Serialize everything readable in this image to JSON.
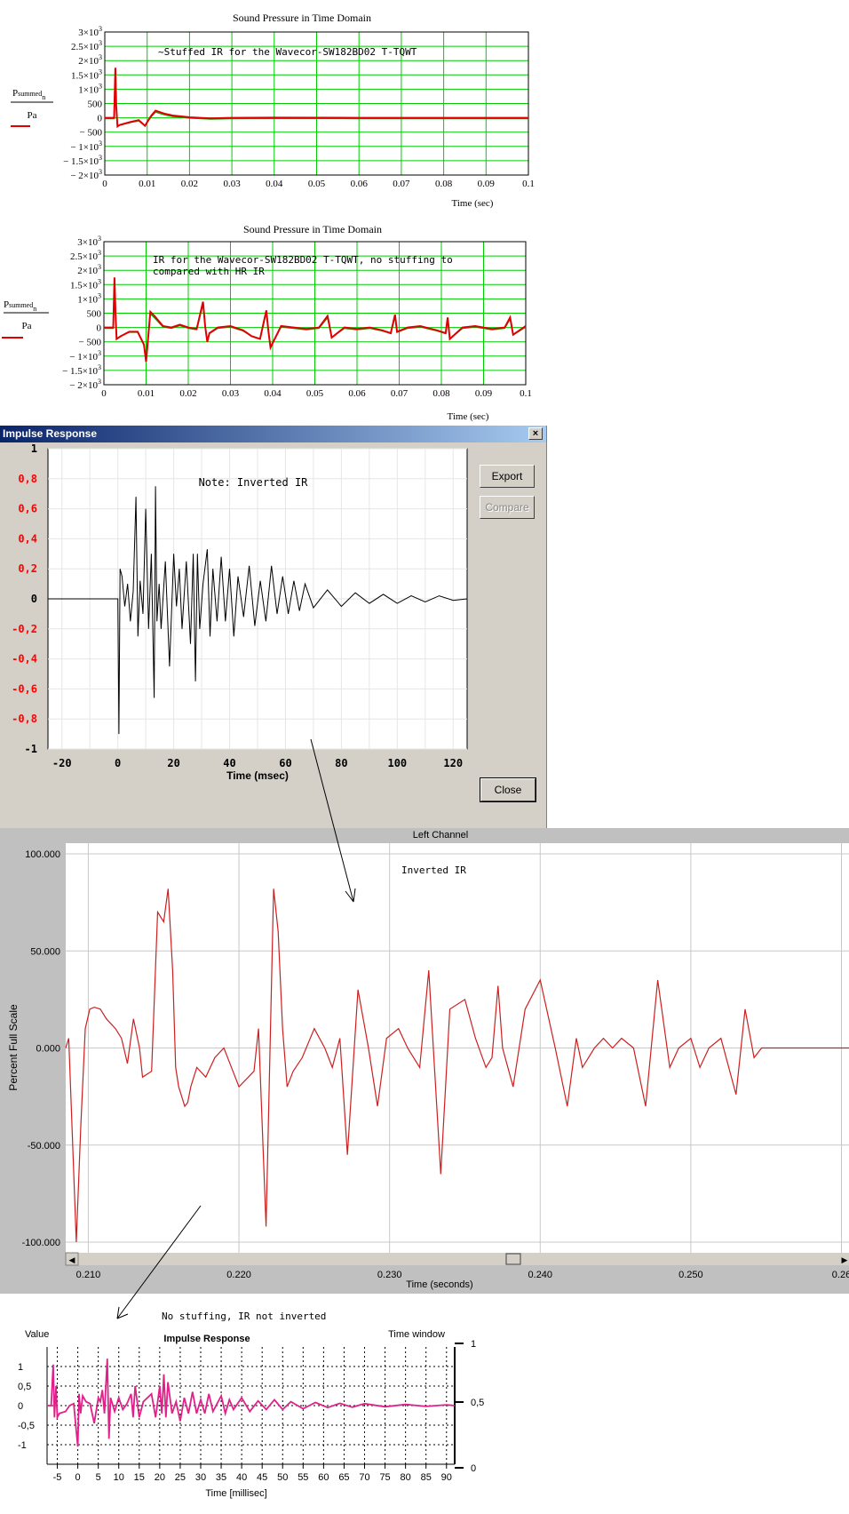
{
  "colors": {
    "grid_green": "#00cc00",
    "trace_red": "#e00000",
    "trace_green": "#00aa00",
    "label_red": "#ff0000",
    "dialog_bg": "#d4d0c8",
    "trace_magenta": "#e0218a",
    "lc_red": "#cc2020"
  },
  "chart1": {
    "title": "Sound Pressure in Time Domain",
    "annotation": "~Stuffed IR for the Wavecor-SW182BD02 T-TQWT",
    "ylabel_top": "P",
    "ylabel_sub": "summed",
    "ylabel_idx": "n",
    "ylabel_unit": "Pa",
    "xlabel": "Time (sec)",
    "yticks": [
      "3×10",
      "2.5×10",
      "2×10",
      "1.5×10",
      "1×10",
      "500",
      "0",
      "− 500",
      "− 1×10",
      "− 1.5×10",
      "− 2×10"
    ],
    "yexp": [
      "3",
      "3",
      "3",
      "3",
      "3",
      "",
      "",
      "",
      "3",
      "3",
      "3"
    ],
    "xticks": [
      "0",
      "0.01",
      "0.02",
      "0.03",
      "0.04",
      "0.05",
      "0.06",
      "0.07",
      "0.08",
      "0.09",
      "0.1"
    ]
  },
  "chart2": {
    "title": "Sound Pressure in Time Domain",
    "annotation_l1": "IR for the Wavecor-SW182BD02 T-TQWT, no stuffing to",
    "annotation_l2": "compared with HR IR",
    "ylabel_top": "P",
    "ylabel_sub": "summed",
    "ylabel_idx": "n",
    "ylabel_unit": "Pa",
    "xlabel": "Time (sec)",
    "yticks": [
      "3×10",
      "2.5×10",
      "2×10",
      "1.5×10",
      "1×10",
      "500",
      "0",
      "− 500",
      "− 1×10",
      "− 1.5×10",
      "− 2×10"
    ],
    "yexp": [
      "3",
      "3",
      "3",
      "3",
      "3",
      "",
      "",
      "",
      "3",
      "3",
      "3"
    ],
    "xticks": [
      "0",
      "0.01",
      "0.02",
      "0.03",
      "0.04",
      "0.05",
      "0.06",
      "0.07",
      "0.08",
      "0.09",
      "0.1"
    ]
  },
  "dialog": {
    "title": "Impulse Response",
    "close_x": "×",
    "export_label": "Export",
    "compare_label": "Compare",
    "close_label": "Close",
    "note": "Note: Inverted IR",
    "yticks": [
      "1",
      "0,8",
      "0,6",
      "0,4",
      "0,2",
      "0",
      "-0,2",
      "-0,4",
      "-0,6",
      "-0,8",
      "-1"
    ],
    "xticks": [
      "-20",
      "0",
      "20",
      "40",
      "60",
      "80",
      "100",
      "120"
    ],
    "xlabel": "Time (msec)"
  },
  "left_channel": {
    "title": "Left Channel",
    "annotation": "Inverted IR",
    "ylabel": "Percent Full Scale",
    "yticks": [
      "100.000",
      "50.000",
      "0.000",
      "-50.000",
      "-100.000"
    ],
    "xticks": [
      "0.210",
      "0.220",
      "0.230",
      "0.240",
      "0.250",
      "0.26"
    ],
    "xlabel": "Time (seconds)",
    "scroll_left": "◀",
    "scroll_right": "▶"
  },
  "chart5": {
    "caption": "No stuffing,  IR not inverted",
    "title": "Impulse Response",
    "value_label": "Value",
    "time_window_label": "Time window",
    "yticks": [
      "1",
      "0,5",
      "0",
      "-0,5",
      "-1"
    ],
    "y2ticks": [
      "1",
      "0,5",
      "0"
    ],
    "xticks": [
      "-5",
      "0",
      "5",
      "10",
      "15",
      "20",
      "25",
      "30",
      "35",
      "40",
      "45",
      "50",
      "55",
      "60",
      "65",
      "70",
      "75",
      "80",
      "85",
      "90"
    ],
    "xlabel": "Time [millisec]"
  },
  "chart_data": [
    {
      "type": "line",
      "title": "Sound Pressure in Time Domain",
      "xlabel": "Time (sec)",
      "ylabel": "P summed n / Pa",
      "xlim": [
        0,
        0.1
      ],
      "ylim": [
        -2000,
        3000
      ],
      "grid": true,
      "series": [
        {
          "x": [
            0,
            0.0022,
            0.0025,
            0.0027,
            0.003,
            0.0035,
            0.006,
            0.008,
            0.0095,
            0.0102,
            0.011,
            0.012,
            0.014,
            0.016,
            0.02,
            0.025,
            0.03,
            0.04,
            0.06,
            0.1
          ],
          "y": [
            0,
            0,
            1750,
            400,
            -300,
            -250,
            -150,
            -80,
            -280,
            -100,
            80,
            250,
            150,
            80,
            20,
            -20,
            0,
            5,
            0,
            0
          ]
        }
      ]
    },
    {
      "type": "line",
      "title": "Sound Pressure in Time Domain",
      "xlabel": "Time (sec)",
      "ylabel": "P summed n / Pa",
      "xlim": [
        0,
        0.1
      ],
      "ylim": [
        -2000,
        3000
      ],
      "grid": true,
      "series": [
        {
          "x": [
            0,
            0.0022,
            0.0025,
            0.0028,
            0.003,
            0.004,
            0.006,
            0.008,
            0.0095,
            0.01,
            0.011,
            0.012,
            0.014,
            0.016,
            0.018,
            0.02,
            0.022,
            0.0235,
            0.024,
            0.0245,
            0.025,
            0.027,
            0.03,
            0.033,
            0.035,
            0.037,
            0.0385,
            0.039,
            0.0395,
            0.042,
            0.045,
            0.048,
            0.051,
            0.053,
            0.0535,
            0.054,
            0.057,
            0.06,
            0.063,
            0.066,
            0.068,
            0.069,
            0.0695,
            0.072,
            0.075,
            0.079,
            0.081,
            0.0815,
            0.082,
            0.085,
            0.088,
            0.09,
            0.092,
            0.095,
            0.0963,
            0.097,
            0.1
          ],
          "y": [
            0,
            0,
            1750,
            300,
            -400,
            -300,
            -150,
            -150,
            -600,
            -1200,
            550,
            400,
            50,
            0,
            100,
            0,
            -50,
            900,
            50,
            -500,
            -200,
            0,
            50,
            -100,
            -300,
            -400,
            600,
            -150,
            -700,
            50,
            0,
            -50,
            0,
            400,
            50,
            -350,
            0,
            -50,
            0,
            -100,
            -200,
            450,
            -150,
            0,
            50,
            -100,
            -200,
            350,
            -400,
            0,
            50,
            0,
            -50,
            0,
            350,
            -250,
            50
          ]
        }
      ]
    },
    {
      "type": "line",
      "title": "",
      "xlabel": "Time (msec)",
      "xlim": [
        -25,
        125
      ],
      "ylim": [
        -1,
        1
      ],
      "grid": true,
      "series": [
        {
          "x": [
            -25,
            0,
            0.4,
            0.8,
            1.5,
            2.5,
            3.5,
            4.5,
            5.5,
            6.5,
            7.2,
            8,
            9,
            10,
            11,
            12,
            13,
            13.5,
            14,
            14.8,
            15.5,
            17,
            18.5,
            20,
            21,
            22,
            23,
            24.5,
            26,
            27,
            27.8,
            28.5,
            29.3,
            30.5,
            32,
            33,
            34,
            35.5,
            37,
            38.5,
            40,
            41.5,
            43,
            45,
            47,
            49,
            51,
            53,
            55,
            57,
            59,
            61,
            63,
            65,
            67,
            70,
            75,
            80,
            85,
            90,
            95,
            100,
            105,
            110,
            115,
            120,
            125
          ],
          "y": [
            0,
            0,
            -0.9,
            0.2,
            0.15,
            -0.05,
            0.1,
            -0.15,
            0.05,
            0.68,
            -0.25,
            0.12,
            -0.1,
            0.6,
            -0.2,
            0.3,
            -0.66,
            0.75,
            -0.15,
            0.1,
            -0.2,
            0.25,
            -0.45,
            0.3,
            -0.05,
            0.2,
            -0.2,
            0.25,
            -0.3,
            0.3,
            -0.55,
            0.3,
            -0.2,
            0.1,
            0.33,
            -0.25,
            0.2,
            -0.15,
            0.28,
            -0.15,
            0.2,
            -0.25,
            0.15,
            -0.12,
            0.22,
            -0.18,
            0.12,
            -0.15,
            0.22,
            -0.1,
            0.15,
            -0.1,
            0.12,
            -0.08,
            0.1,
            -0.06,
            0.06,
            -0.05,
            0.04,
            -0.03,
            0.03,
            -0.03,
            0.02,
            -0.02,
            0.02,
            -0.01,
            0
          ]
        }
      ]
    },
    {
      "type": "line",
      "title": "Left Channel",
      "xlabel": "Time (seconds)",
      "ylabel": "Percent Full Scale",
      "xlim": [
        0.2085,
        0.2605
      ],
      "ylim": [
        -100,
        100
      ],
      "grid": true,
      "series": [
        {
          "x": [
            0.2085,
            0.2087,
            0.2092,
            0.2095,
            0.2098,
            0.2101,
            0.2104,
            0.2108,
            0.2112,
            0.2118,
            0.2122,
            0.2126,
            0.213,
            0.2134,
            0.2136,
            0.2142,
            0.2146,
            0.215,
            0.2153,
            0.2156,
            0.2158,
            0.216,
            0.2162,
            0.2164,
            0.2166,
            0.2168,
            0.2172,
            0.2178,
            0.2184,
            0.219,
            0.22,
            0.221,
            0.2213,
            0.2218,
            0.2223,
            0.2226,
            0.2229,
            0.2232,
            0.2236,
            0.2242,
            0.225,
            0.2257,
            0.2262,
            0.2267,
            0.2272,
            0.2279,
            0.2286,
            0.2292,
            0.2298,
            0.2306,
            0.2312,
            0.232,
            0.2326,
            0.2334,
            0.234,
            0.235,
            0.2357,
            0.2364,
            0.2368,
            0.2372,
            0.2375,
            0.2382,
            0.239,
            0.24,
            0.241,
            0.2418,
            0.2424,
            0.2428,
            0.2436,
            0.2442,
            0.2448,
            0.2454,
            0.2462,
            0.247,
            0.2478,
            0.2486,
            0.2492,
            0.25,
            0.2506,
            0.2512,
            0.252,
            0.253,
            0.2536,
            0.2542,
            0.2547,
            0.2552,
            0.2556,
            0.2562,
            0.2568,
            0.2576,
            0.2584,
            0.2592,
            0.2598,
            0.2605
          ],
          "y": [
            0,
            5,
            -100,
            -40,
            10,
            20,
            21,
            20,
            15,
            10,
            5,
            -8,
            15,
            0,
            -15,
            -12,
            70,
            65,
            82,
            40,
            -10,
            -20,
            -25,
            -30,
            -28,
            -20,
            -10,
            -15,
            -5,
            0,
            -20,
            -12,
            10,
            -92,
            82,
            60,
            10,
            -20,
            -12,
            -5,
            10,
            0,
            -10,
            5,
            -55,
            30,
            0,
            -30,
            5,
            10,
            0,
            -10,
            40,
            -65,
            20,
            25,
            5,
            -10,
            -5,
            32,
            0,
            -20,
            20,
            35,
            0,
            -30,
            5,
            -10,
            0,
            5,
            0,
            5,
            0,
            -30,
            35,
            -10,
            0,
            5,
            -10,
            0,
            5,
            -24,
            20,
            -5,
            0,
            0,
            0,
            0,
            0,
            0,
            0,
            0,
            0,
            0
          ]
        }
      ]
    },
    {
      "type": "line",
      "title": "Impulse Response",
      "xlabel": "Time [millisec]",
      "ylabel": "Value",
      "xlim": [
        -7.5,
        92
      ],
      "ylim": [
        -1.5,
        1.5
      ],
      "grid": true,
      "series": [
        {
          "x": [
            -7.5,
            -6.5,
            -6,
            -5.7,
            -5.3,
            -5,
            -4.5,
            -3,
            -2,
            -1,
            0,
            0.3,
            0.7,
            1.2,
            2,
            3,
            4,
            5,
            5.5,
            6,
            6.5,
            7.2,
            7.6,
            8,
            9,
            10,
            11,
            12,
            13,
            13.5,
            14,
            15,
            16,
            18,
            19,
            20,
            20.5,
            21,
            21.5,
            22,
            23,
            24,
            25,
            26,
            27,
            28,
            29,
            30,
            31,
            32,
            33,
            35,
            36,
            37,
            38,
            40,
            42,
            44,
            46,
            48,
            50,
            52,
            55,
            58,
            61,
            64,
            67,
            70,
            75,
            80,
            85,
            90,
            92
          ],
          "y": [
            0,
            0,
            1.05,
            -0.3,
            0.5,
            -0.3,
            -0.2,
            -0.15,
            0,
            0.05,
            -1.05,
            0.3,
            -0.2,
            0.25,
            0.1,
            0.05,
            -0.45,
            0.2,
            0.1,
            0.4,
            -0.2,
            1.2,
            -0.85,
            0.2,
            -0.15,
            0.2,
            -0.1,
            0.05,
            0.3,
            -0.3,
            0.5,
            -0.3,
            0.1,
            0.3,
            -0.3,
            0.5,
            -0.2,
            0.8,
            -0.3,
            0.6,
            -0.2,
            0.1,
            -0.4,
            0.2,
            -0.2,
            0.35,
            -0.2,
            0.15,
            -0.2,
            0.3,
            -0.15,
            0.25,
            -0.2,
            0.15,
            -0.1,
            0.2,
            -0.15,
            0.12,
            -0.1,
            0.15,
            -0.1,
            0.1,
            -0.08,
            0.08,
            -0.05,
            0.06,
            -0.04,
            0.05,
            -0.03,
            0.03,
            -0.02,
            0.02,
            0
          ]
        }
      ]
    }
  ]
}
